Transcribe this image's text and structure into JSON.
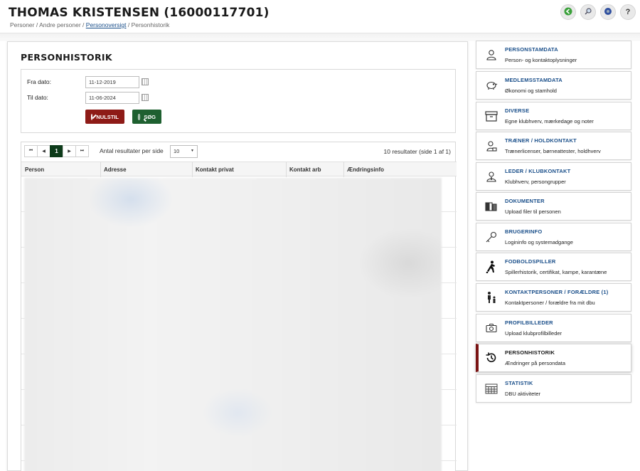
{
  "header": {
    "title": "THOMAS KRISTENSEN (16000117701)",
    "breadcrumb": {
      "part1": "Personer / Andre personer / ",
      "link": "Personoversigt",
      "part2": " / Personhistorik"
    },
    "buttons": [
      {
        "name": "back",
        "color": "#3aa03a"
      },
      {
        "name": "search",
        "color": "#d8d8d8"
      },
      {
        "name": "support",
        "color": "#3050a0"
      },
      {
        "name": "help",
        "label": "?"
      }
    ]
  },
  "main": {
    "title": "PERSONHISTORIK",
    "filter": {
      "from_label": "Fra dato:",
      "from_value": "11-12-2019",
      "to_label": "Til dato:",
      "to_value": "11-06-2024",
      "reset_label": "NULSTIL",
      "search_label": "SØG"
    },
    "grid": {
      "pager": {
        "first": "⏮",
        "prev": "◀",
        "current": "1",
        "next": "▶",
        "last": "⏭"
      },
      "per_page_label": "Antal resultater per side",
      "per_page_value": "10",
      "result_count": "10 resultater (side 1 af 1)",
      "columns": [
        "Person",
        "Adresse",
        "Kontakt privat",
        "Kontakt arb",
        "Ændringsinfo"
      ]
    }
  },
  "menu": [
    {
      "title": "PERSONSTAMDATA",
      "subtitle": "Person- og kontaktoplysninger",
      "icon": "person-icon"
    },
    {
      "title": "MEDLEMSSTAMDATA",
      "subtitle": "Økonomi og stamhold",
      "icon": "piggy-bank-icon"
    },
    {
      "title": "DIVERSE",
      "subtitle": "Egne klubhverv, mærkedage og noter",
      "icon": "archive-box-icon"
    },
    {
      "title": "TRÆNER / HOLDKONTAKT",
      "subtitle": "Trænerlicenser, børneattester, holdhverv",
      "icon": "coach-icon"
    },
    {
      "title": "LEDER / KLUBKONTAKT",
      "subtitle": "Klubhverv, persongrupper",
      "icon": "leader-icon"
    },
    {
      "title": "DOKUMENTER",
      "subtitle": "Upload filer til personen",
      "icon": "binders-icon"
    },
    {
      "title": "BRUGERINFO",
      "subtitle": "Logininfo og systemadgange",
      "icon": "key-icon"
    },
    {
      "title": "FODBOLDSPILLER",
      "subtitle": "Spillerhistorik, certifikat, kampe, karantæne",
      "icon": "football-player-icon"
    },
    {
      "title": "KONTAKTPERSONER / FORÆLDRE (1)",
      "subtitle": "Kontaktpersoner / forældre fra mit dbu",
      "icon": "parent-child-icon"
    },
    {
      "title": "PROFILBILLEDER",
      "subtitle": "Upload klubprofilbilleder",
      "icon": "camera-icon"
    },
    {
      "title": "PERSONHISTORIK",
      "subtitle": "Ændringer på persondata",
      "icon": "history-icon",
      "active": true
    },
    {
      "title": "STATISTIK",
      "subtitle": "DBU aktiviteter",
      "icon": "calendar-icon"
    }
  ]
}
